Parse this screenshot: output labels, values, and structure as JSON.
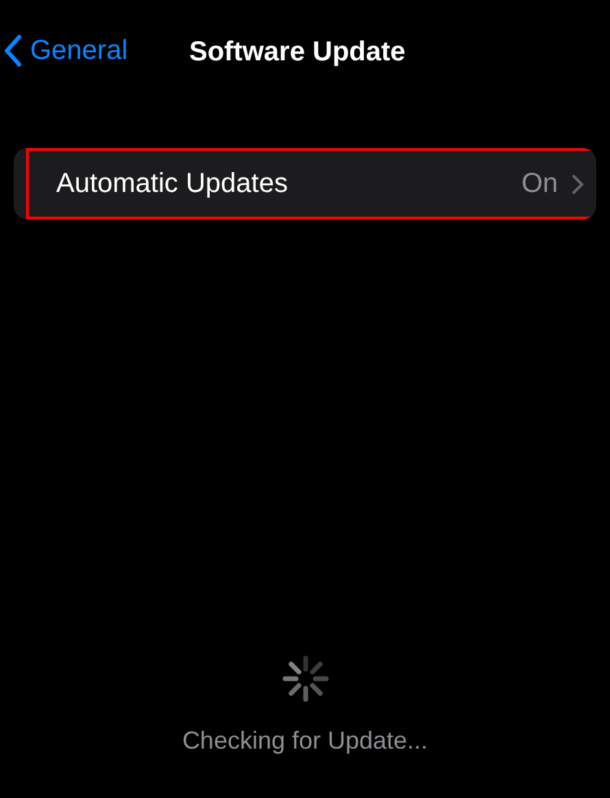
{
  "nav": {
    "back_label": "General",
    "title": "Software Update"
  },
  "settings": [
    {
      "label": "Automatic Updates",
      "value": "On",
      "highlighted": true
    }
  ],
  "status": {
    "text": "Checking for Update..."
  }
}
